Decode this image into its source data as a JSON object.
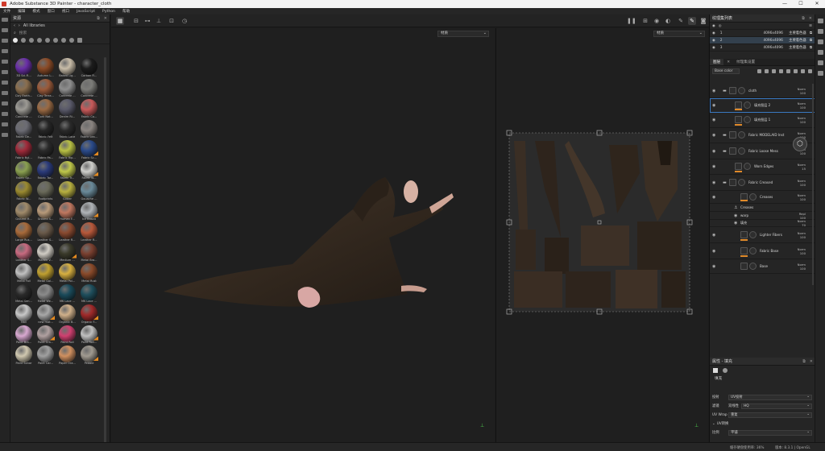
{
  "window": {
    "title": "Adobe Substance 3D Painter - character_cloth"
  },
  "menu": [
    "文件",
    "编辑",
    "模式",
    "窗口",
    "视口",
    "JavaScript",
    "Python",
    "帮助"
  ],
  "shelf": {
    "title": "资源",
    "crumb": "All libraries",
    "search_placeholder": "搜索",
    "materials": [
      {
        "label": "3D Sci-Fi...",
        "color": "#6a2fa8",
        "new": false
      },
      {
        "label": "Autumn L...",
        "color": "#8a4a26",
        "new": false
      },
      {
        "label": "Baked Lig...",
        "color": "#c8bca8",
        "new": false
      },
      {
        "label": "Carbon Fi...",
        "color": "#1c1c1c",
        "new": false
      },
      {
        "label": "Clay Earth...",
        "color": "#8a6e4e",
        "new": false
      },
      {
        "label": "Clay Terra...",
        "color": "#9a5a3a",
        "new": false
      },
      {
        "label": "Concrete ...",
        "color": "#8e8e8e",
        "new": false
      },
      {
        "label": "Concrete ...",
        "color": "#7c7c78",
        "new": false
      },
      {
        "label": "Concrete ...",
        "color": "#9c9a94",
        "new": false
      },
      {
        "label": "Cork Nat...",
        "color": "#9a6a44",
        "new": false
      },
      {
        "label": "Denim Ri...",
        "color": "#5a5a6a",
        "new": false
      },
      {
        "label": "Fabric Co...",
        "color": "#c85a5a",
        "new": false
      },
      {
        "label": "Fabric De...",
        "color": "#6c6c74",
        "new": false
      },
      {
        "label": "Fabric Felt",
        "color": "#262626",
        "new": false
      },
      {
        "label": "Fabric Lace",
        "color": "#2a2a2a",
        "new": false
      },
      {
        "label": "Fabric Lea...",
        "color": "#8a8480",
        "new": false
      },
      {
        "label": "Fabric Nyl...",
        "color": "#a02a3a",
        "new": false
      },
      {
        "label": "Fabric Pa...",
        "color": "#2a2a2a",
        "new": false
      },
      {
        "label": "Fabric Rip...",
        "color": "#b8c044",
        "new": false
      },
      {
        "label": "Fabric Sc...",
        "color": "#2a4a8a",
        "new": true
      },
      {
        "label": "Fabric Sp...",
        "color": "#8aa050",
        "new": false
      },
      {
        "label": "Fabric Tar...",
        "color": "#2a3a7a",
        "new": false
      },
      {
        "label": "Fabric Tr...",
        "color": "#c0c84a",
        "new": false
      },
      {
        "label": "Fabric W...",
        "color": "#d0d0cc",
        "new": true
      },
      {
        "label": "Fabric W...",
        "color": "#9a8a30",
        "new": false
      },
      {
        "label": "Footprints",
        "color": "#6a6a5a",
        "new": false
      },
      {
        "label": "Glitter",
        "color": "#b8b040",
        "new": false
      },
      {
        "label": "Gouache ...",
        "color": "#6a8a9a",
        "new": false
      },
      {
        "label": "Ground M...",
        "color": "#a08a6a",
        "new": false
      },
      {
        "label": "Ground S...",
        "color": "#b89a7a",
        "new": false
      },
      {
        "label": "Human F...",
        "color": "#c07860",
        "new": false
      },
      {
        "label": "Ice Basalt",
        "color": "#b0b4b8",
        "new": true
      },
      {
        "label": "Large Rus...",
        "color": "#a86a3a",
        "new": false
      },
      {
        "label": "Leather S...",
        "color": "#6a5a4a",
        "new": false
      },
      {
        "label": "Leather R...",
        "color": "#8a4a30",
        "new": false
      },
      {
        "label": "Leather R...",
        "color": "#b8583a",
        "new": false
      },
      {
        "label": "Leather S...",
        "color": "#c86a80",
        "new": false
      },
      {
        "label": "Marble V...",
        "color": "#d0ccc4",
        "new": false
      },
      {
        "label": "Medium ...",
        "color": "#3a3a2a",
        "new": true
      },
      {
        "label": "Metal Bra...",
        "color": "#7a4030",
        "new": false
      },
      {
        "label": "Metal Foil",
        "color": "#c0c0c0",
        "new": false
      },
      {
        "label": "Metal Gol...",
        "color": "#c0a030",
        "new": false
      },
      {
        "label": "Metal Pol...",
        "color": "#d8b040",
        "new": false
      },
      {
        "label": "Metal Rust",
        "color": "#8a4a2a",
        "new": false
      },
      {
        "label": "Metal Sen...",
        "color": "#2a2a2a",
        "new": false
      },
      {
        "label": "Metal We...",
        "color": "#8a8a8a",
        "new": false
      },
      {
        "label": "MK Lace ...",
        "color": "#1a4a5a",
        "new": false
      },
      {
        "label": "MK Lace ...",
        "color": "#1e4e5c",
        "new": false
      },
      {
        "label": "Nail",
        "color": "#c8c8c8",
        "new": false
      },
      {
        "label": "new mat...",
        "color": "#a8a8a8",
        "new": true
      },
      {
        "label": "Organic B...",
        "color": "#d0b08a",
        "new": false
      },
      {
        "label": "Organic F...",
        "color": "#a02a2a",
        "new": true
      },
      {
        "label": "Paint Bra...",
        "color": "#d8a8d0",
        "new": false
      },
      {
        "label": "Paint Cra...",
        "color": "#b0a0a0",
        "new": true
      },
      {
        "label": "Paint Roll",
        "color": "#d04070",
        "new": false
      },
      {
        "label": "Paint Roll...",
        "color": "#c0c0c0",
        "new": true
      },
      {
        "label": "Paint Sonar",
        "color": "#d0c8b0",
        "new": false
      },
      {
        "label": "Paint Car...",
        "color": "#a0a0a0",
        "new": false
      },
      {
        "label": "Paper Ora...",
        "color": "#d09060",
        "new": false
      },
      {
        "label": "Pebble",
        "color": "#a09a90",
        "new": true
      }
    ]
  },
  "viewport": {
    "dropdown_3d": "材质",
    "dropdown_2d": "材质"
  },
  "textureset": {
    "title": "纹理集列表",
    "rows": [
      {
        "id": "1",
        "res": "4096x4096",
        "shader": "主要着色器",
        "selected": false
      },
      {
        "id": "2",
        "res": "4096x4096",
        "shader": "主要着色器",
        "selected": true
      },
      {
        "id": "3",
        "res": "4096x4096",
        "shader": "主要着色器",
        "selected": false
      }
    ]
  },
  "layers": {
    "tab_layers": "图层",
    "tab_settings": "纹理集设置",
    "channel": "Base color",
    "items": [
      {
        "name": "cloth",
        "blend": "Norm",
        "opacity": "100",
        "indent": 0,
        "type": "folder",
        "bar": false
      },
      {
        "name": "填充图层 2",
        "blend": "Norm",
        "opacity": "100",
        "indent": 1,
        "type": "fill",
        "bar": true,
        "selected": true
      },
      {
        "name": "填充图层 1",
        "blend": "Norm",
        "opacity": "100",
        "indent": 1,
        "type": "fill",
        "bar": true
      },
      {
        "name": "Fabric MODELAID Inst",
        "blend": "Norm",
        "opacity": "100",
        "indent": 0,
        "type": "folder",
        "bar": false
      },
      {
        "name": "Fabric Loose Mess",
        "blend": "Norm",
        "opacity": "100",
        "indent": 0,
        "type": "folder",
        "bar": false
      },
      {
        "name": "Worn Edges",
        "blend": "Norm",
        "opacity": "15",
        "indent": 1,
        "type": "fill",
        "bar": true
      },
      {
        "name": "Fabric Creased",
        "blend": "Norm",
        "opacity": "100",
        "indent": 0,
        "type": "folder",
        "bar": false
      },
      {
        "name": "Creases",
        "blend": "Norm",
        "opacity": "100",
        "indent": 2,
        "type": "fill",
        "bar": true
      },
      {
        "name": "Creases",
        "blend": "",
        "opacity": "",
        "indent": 2,
        "type": "anchor",
        "bar": false
      },
      {
        "name": "warp",
        "blend": "Repl",
        "opacity": "100",
        "indent": 2,
        "type": "effect",
        "bar": false
      },
      {
        "name": "填充",
        "blend": "Norm",
        "opacity": "70",
        "indent": 2,
        "type": "effect",
        "bar": false
      },
      {
        "name": "Lighter Fibers",
        "blend": "Norm",
        "opacity": "100",
        "indent": 2,
        "type": "fill",
        "bar": true
      },
      {
        "name": "Fabric Base",
        "blend": "Norm",
        "opacity": "100",
        "indent": 2,
        "type": "fill",
        "bar": true
      },
      {
        "name": "Base",
        "blend": "Norm",
        "opacity": "100",
        "indent": 2,
        "type": "fill",
        "bar": false
      }
    ]
  },
  "properties": {
    "title": "属性 - 填充",
    "section": "填充",
    "rows": [
      {
        "key": "投射",
        "value": "UV投射"
      },
      {
        "key": "滤镜",
        "value": "双线性",
        "extra": "HQ"
      },
      {
        "key": "UV Wrap",
        "value": "重复"
      },
      {
        "key": "UV转换",
        "value": ""
      },
      {
        "key": "比例",
        "value": "平铺"
      }
    ]
  },
  "status": {
    "left": "",
    "right": "缓存硬盘使用率: 36%",
    "version": "版本: 8.3.1 | OpenGL"
  }
}
